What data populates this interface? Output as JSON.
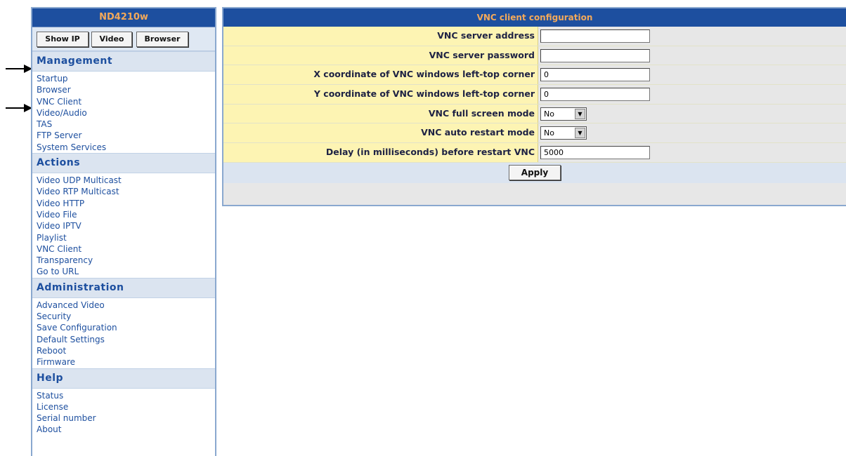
{
  "sidebar": {
    "brand": "ND4210w",
    "buttons": [
      "Show IP",
      "Video",
      "Browser"
    ],
    "sections": [
      {
        "title": "Management",
        "items": [
          "Startup",
          "Browser",
          "VNC Client",
          "Video/Audio",
          "TAS",
          "FTP Server",
          "System Services"
        ]
      },
      {
        "title": "Actions",
        "items": [
          "Video UDP Multicast",
          "Video RTP Multicast",
          "Video HTTP",
          "Video File",
          "Video IPTV",
          "Playlist",
          "VNC Client",
          "Transparency",
          "Go to URL"
        ]
      },
      {
        "title": "Administration",
        "items": [
          "Advanced Video",
          "Security",
          "Save Configuration",
          "Default Settings",
          "Reboot",
          "Firmware"
        ]
      },
      {
        "title": "Help",
        "items": [
          "Status",
          "License",
          "Serial number",
          "About"
        ]
      }
    ]
  },
  "main": {
    "title": "VNC client configuration",
    "fields": [
      {
        "label": "VNC server address",
        "type": "text",
        "value": ""
      },
      {
        "label": "VNC server password",
        "type": "text",
        "value": ""
      },
      {
        "label": "X coordinate of VNC windows left-top corner",
        "type": "text",
        "value": "0"
      },
      {
        "label": "Y coordinate of VNC windows left-top corner",
        "type": "text",
        "value": "0"
      },
      {
        "label": "VNC full screen mode",
        "type": "select",
        "value": "No"
      },
      {
        "label": "VNC auto restart mode",
        "type": "select",
        "value": "No"
      },
      {
        "label": "Delay (in milliseconds) before restart VNC",
        "type": "text",
        "value": "5000"
      }
    ],
    "apply_label": "Apply"
  },
  "colors": {
    "header_bg": "#1d4f9f",
    "header_text": "#f3a95a",
    "label_bg": "#fdf4b3",
    "link": "#1d4f9f"
  }
}
